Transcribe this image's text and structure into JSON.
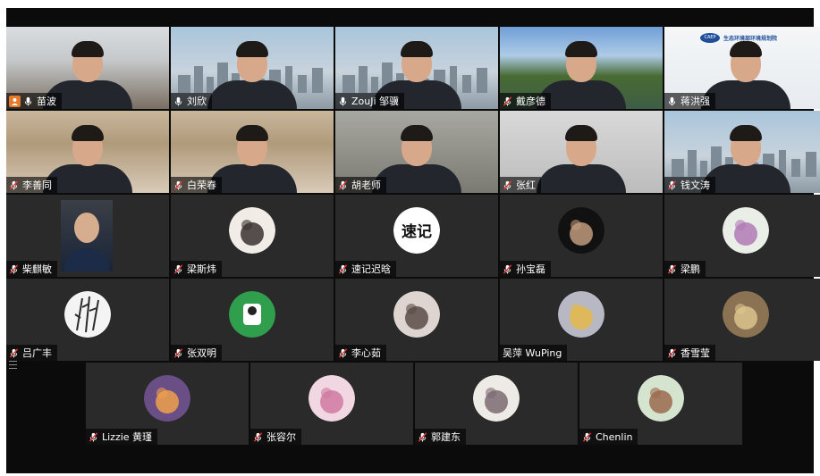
{
  "meeting": {
    "tiles": [
      {
        "name": "苗波",
        "kind": "video",
        "bg": "v-office",
        "mic": "on",
        "user_icon": true
      },
      {
        "name": "刘欣",
        "kind": "video",
        "bg": "v-city",
        "mic": "on",
        "active": true
      },
      {
        "name": "ZouJi 邹骥",
        "kind": "video",
        "bg": "v-city",
        "mic": "on"
      },
      {
        "name": "戴彦德",
        "kind": "video",
        "bg": "v-lake",
        "mic": "muted"
      },
      {
        "name": "蒋洪强",
        "kind": "video",
        "bg": "v-white",
        "mic": "on",
        "logo": true
      },
      {
        "name": "李善同",
        "kind": "video",
        "bg": "v-shelf",
        "mic": "muted"
      },
      {
        "name": "白荣春",
        "kind": "video",
        "bg": "v-shelf",
        "mic": "muted"
      },
      {
        "name": "胡老师",
        "kind": "video",
        "bg": "v-room",
        "mic": "muted"
      },
      {
        "name": "张红",
        "kind": "video",
        "bg": "v-plain",
        "mic": "muted"
      },
      {
        "name": "钱文涛",
        "kind": "video",
        "bg": "v-city",
        "mic": "muted"
      },
      {
        "name": "柴麒敏",
        "kind": "photo",
        "mic": "muted"
      },
      {
        "name": "梁斯炜",
        "kind": "avatar",
        "avatar": "portrait-avatar",
        "mic": "muted"
      },
      {
        "name": "速记迟晗",
        "kind": "avatar",
        "avatar": "text-avatar",
        "avatar_text": "速记",
        "mic": "muted"
      },
      {
        "name": "孙宝磊",
        "kind": "avatar",
        "avatar": "couple-avatar",
        "mic": "muted"
      },
      {
        "name": "梁鹏",
        "kind": "avatar",
        "avatar": "flowers-avatar",
        "mic": "muted"
      },
      {
        "name": "吕广丰",
        "kind": "avatar",
        "avatar": "bamboo-avatar",
        "mic": "muted"
      },
      {
        "name": "张双明",
        "kind": "avatar",
        "avatar": "cartoon-avatar",
        "mic": "muted"
      },
      {
        "name": "李心茹",
        "kind": "avatar",
        "avatar": "girl-avatar",
        "mic": "muted"
      },
      {
        "name": "吴萍 WuPing",
        "kind": "avatar",
        "avatar": "blossom-avatar",
        "mic": "none"
      },
      {
        "name": "香雪莹",
        "kind": "avatar",
        "avatar": "sprout-avatar",
        "mic": "muted"
      },
      {
        "name": "Lizzie 黄瑾",
        "kind": "avatar",
        "avatar": "cityscape-avatar",
        "mic": "muted"
      },
      {
        "name": "张容尔",
        "kind": "avatar",
        "avatar": "flower-pink-avatar",
        "mic": "muted"
      },
      {
        "name": "郭建东",
        "kind": "avatar",
        "avatar": "branch-avatar",
        "mic": "muted"
      },
      {
        "name": "Chenlin",
        "kind": "avatar",
        "avatar": "jar-avatar",
        "mic": "muted"
      }
    ],
    "logo_text": "生态环境部环境规划院",
    "logo_mark": "CAEP",
    "colors": {
      "active_border": "#2ec45a",
      "muted_mic": "#e23b3b",
      "tile_bg": "#2a2a2b",
      "frame_bg": "#0b0b0c"
    }
  }
}
